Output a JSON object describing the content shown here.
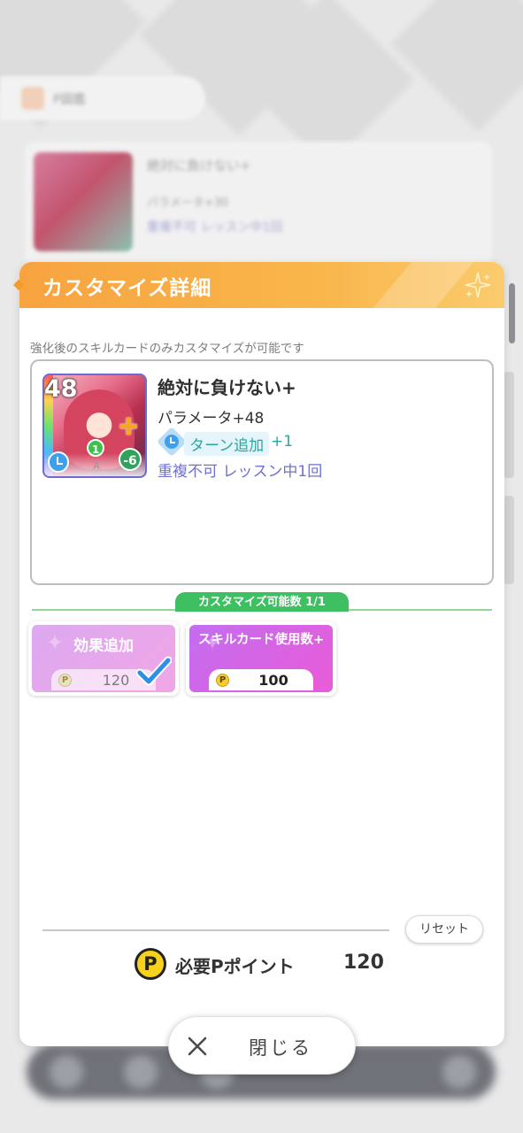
{
  "background": {
    "pill_label": "P図鑑",
    "card_title": "絶対に負けない+",
    "card_param": "パラメータ+30",
    "card_limit": "重複不可 レッスン中1回"
  },
  "modal": {
    "title": "カスタマイズ詳細",
    "notice": "強化後のスキルカードのみカスタマイズが可能です",
    "card": {
      "cost": "48",
      "rank": "A",
      "level_badge": "1",
      "stamina": "-6",
      "name": "絶対に負けない+",
      "param": "パラメータ+48",
      "effect_label": "ターン追加",
      "effect_value": "+1",
      "limit": "重複不可 レッスン中1回"
    },
    "customize_count": "カスタマイズ可能数 1/1",
    "options": [
      {
        "label": "効果追加",
        "price": "120",
        "coin": "P",
        "selected": true
      },
      {
        "label": "スキルカード使用数+",
        "price": "100",
        "coin": "P",
        "selected": false
      }
    ],
    "reset_label": "リセット",
    "required": {
      "coin": "P",
      "label": "必要Pポイント",
      "value": "120"
    }
  },
  "close_label": "閉じる",
  "colors": {
    "header_orange": "#f7a33f",
    "count_green": "#3ebf62",
    "option_effect": "#dca9f0",
    "option_usage": "#c26ef0",
    "effect_teal": "#2aa7a0",
    "limit_purple": "#6f6fd8",
    "coin_yellow": "#f7d21c"
  }
}
